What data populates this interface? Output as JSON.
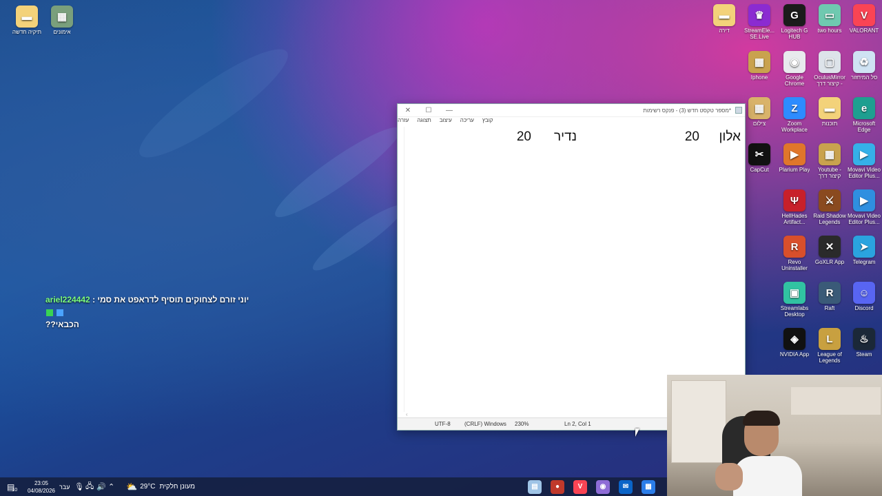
{
  "desktop": {
    "left_icons": [
      {
        "label": "תיקיה חדשה",
        "icon": "folder-icon",
        "color": "#f3d27a"
      },
      {
        "label": "אימונים",
        "icon": "folder-image-icon",
        "color": "#7a9f7c"
      }
    ],
    "right_icons": [
      {
        "label": "דירה",
        "icon": "folder-icon",
        "color": "#f3d27a"
      },
      {
        "label": "StreamEle... SE.Live",
        "icon": "streamelements-icon",
        "color": "#8b2bd1"
      },
      {
        "label": "Logitech G HUB",
        "icon": "logitech-icon",
        "color": "#1b1b1b"
      },
      {
        "label": "two hours",
        "icon": "image-icon",
        "color": "#6fc9b0"
      },
      {
        "label": "VALORANT",
        "icon": "valorant-icon",
        "color": "#fa4454"
      },
      {
        "label": "Iphone",
        "icon": "folder-image-icon",
        "color": "#c9a24e"
      },
      {
        "label": "Google Chrome",
        "icon": "chrome-icon",
        "color": "#e8eaed"
      },
      {
        "label": "OculusMirror קיצור דרך -",
        "icon": "oculus-icon",
        "color": "#dde3ea"
      },
      {
        "label": "סל המיחזור",
        "icon": "recycle-bin-icon",
        "color": "#cfe3f3"
      },
      {
        "label": "צילום",
        "icon": "folder-image-icon",
        "color": "#d9b36a"
      },
      {
        "label": "Zoom Workplace",
        "icon": "zoom-icon",
        "color": "#2d8cff"
      },
      {
        "label": "תוכנות",
        "icon": "folder-icon",
        "color": "#f3d27a"
      },
      {
        "label": "Microsoft Edge",
        "icon": "edge-icon",
        "color": "#1e9f90"
      },
      {
        "label": "CapCut",
        "icon": "capcut-icon",
        "color": "#111111"
      },
      {
        "label": "Plarium Play",
        "icon": "plarium-icon",
        "color": "#e0762b"
      },
      {
        "label": "Youtube - קיצור דרך",
        "icon": "folder-image-icon",
        "color": "#c9a24e"
      },
      {
        "label": "Movavi Video Editor Plus...",
        "icon": "movavi-icon",
        "color": "#35b0e8"
      },
      {
        "label": "HellHades Artifact...",
        "icon": "hellhades-icon",
        "color": "#c8202a"
      },
      {
        "label": "Raid Shadow Legends",
        "icon": "raid-icon",
        "color": "#8a4a1f"
      },
      {
        "label": "Movavi Video Editor Plus...",
        "icon": "movavi-icon",
        "color": "#2f8fe0"
      },
      {
        "label": "Revo Uninstaller",
        "icon": "revo-icon",
        "color": "#d94f2b"
      },
      {
        "label": "GoXLR App",
        "icon": "goxlr-icon",
        "color": "#2a2a2a"
      },
      {
        "label": "Telegram",
        "icon": "telegram-icon",
        "color": "#2aa3df"
      },
      {
        "label": "Streamlabs Desktop",
        "icon": "streamlabs-icon",
        "color": "#31c3a2"
      },
      {
        "label": "Raft",
        "icon": "raft-icon",
        "color": "#3a5a78"
      },
      {
        "label": "Discord",
        "icon": "discord-icon",
        "color": "#5865f2"
      },
      {
        "label": "NVIDIA App",
        "icon": "nvidia-icon",
        "color": "#111111"
      },
      {
        "label": "League of Legends",
        "icon": "lol-icon",
        "color": "#c8a040"
      },
      {
        "label": "Steam",
        "icon": "steam-icon",
        "color": "#1b2838"
      }
    ]
  },
  "chat": {
    "username": "ariel224442",
    "message_part1": "יוני זורם לצחוקים תוסיף לדראפט את סמי :",
    "message_part2": "הכבאי??"
  },
  "notepad": {
    "title": "*מספר טקסט חדש (3) - פנקס רשימות",
    "menu": [
      "קובץ",
      "עריכה",
      "עיצוב",
      "תצוגה",
      "עזרה"
    ],
    "content": {
      "name1": "אלון",
      "value1": "20",
      "name2": "נדיר",
      "value2": "20"
    },
    "status": {
      "position": "Ln 2, Col 1",
      "zoom": "230%",
      "line_ending": "(CRLF) Windows",
      "encoding": "UTF-8"
    }
  },
  "taskbar": {
    "weather_temp": "29°C",
    "weather_desc": "מעונן חלקית",
    "language": "עבר",
    "time": "23:05",
    "date": "04/08/2026",
    "notification_count": "10",
    "apps": [
      {
        "icon": "notepad-taskbar-icon",
        "color": "#9fc4e6"
      },
      {
        "icon": "obs-taskbar-icon",
        "color": "#c0392b"
      },
      {
        "icon": "valorant-taskbar-icon",
        "color": "#fa4454"
      },
      {
        "icon": "streamlabs-taskbar-icon",
        "color": "#8e6cd6"
      },
      {
        "icon": "outlook-taskbar-icon",
        "color": "#0a64c8"
      },
      {
        "icon": "store-taskbar-icon",
        "color": "#2b7de9"
      }
    ]
  }
}
